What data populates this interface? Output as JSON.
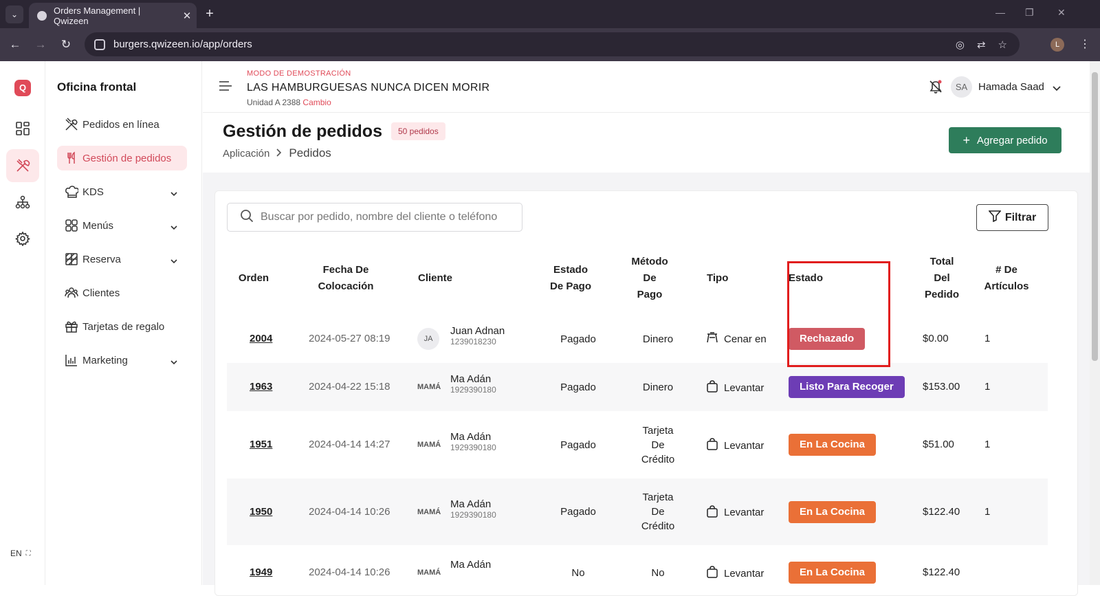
{
  "browser": {
    "tab_title": "Orders Management | Qwizeen",
    "url": "burgers.qwizeen.io/app/orders",
    "profile_initial": "L"
  },
  "sidebar": {
    "title": "Oficina frontal",
    "items": [
      {
        "label": "Pedidos en línea",
        "icon": "dining-icon"
      },
      {
        "label": "Gestión de pedidos",
        "icon": "fork-knife-icon"
      },
      {
        "label": "KDS",
        "icon": "chef-hat-icon"
      },
      {
        "label": "Menús",
        "icon": "grid-icon"
      },
      {
        "label": "Reserva",
        "icon": "table-icon"
      },
      {
        "label": "Clientes",
        "icon": "users-icon"
      },
      {
        "label": "Tarjetas de regalo",
        "icon": "gift-icon"
      },
      {
        "label": "Marketing",
        "icon": "chart-icon"
      }
    ],
    "lang": "EN"
  },
  "header": {
    "demo_label": "MODO DE DEMOSTRACIÓN",
    "store_name": "LAS HAMBURGUESAS NUNCA DICEN MORIR",
    "unit": "Unidad A 2388",
    "change_link": "Cambio",
    "user_initials": "SA",
    "user_name": "Hamada Saad"
  },
  "page": {
    "title": "Gestión de pedidos",
    "count_badge": "50 pedidos",
    "breadcrumb": [
      "Aplicación",
      "Pedidos"
    ],
    "add_button": "Agregar pedido",
    "search_placeholder": "Buscar por pedido, nombre del cliente o teléfono",
    "filter_button": "Filtrar"
  },
  "table": {
    "columns": [
      {
        "key": "order",
        "lines": [
          "Orden"
        ]
      },
      {
        "key": "date",
        "lines": [
          "Fecha De",
          "Colocación"
        ]
      },
      {
        "key": "customer",
        "lines": [
          "Cliente"
        ]
      },
      {
        "key": "pay_status",
        "lines": [
          "Estado",
          "De Pago"
        ]
      },
      {
        "key": "pay_method",
        "lines": [
          "Método",
          "De",
          "Pago"
        ]
      },
      {
        "key": "type",
        "lines": [
          "Tipo"
        ]
      },
      {
        "key": "status",
        "lines": [
          "Estado"
        ]
      },
      {
        "key": "total",
        "lines": [
          "Total",
          "Del",
          "Pedido"
        ]
      },
      {
        "key": "items",
        "lines": [
          "# De",
          "Artículos"
        ]
      }
    ],
    "rows": [
      {
        "order": "2004",
        "date": "2024-05-27 08:19",
        "initials": "JA",
        "name": "Juan Adnan",
        "phone": "1239018230",
        "pay_status": [
          "Pagado"
        ],
        "pay_method": [
          "Dinero"
        ],
        "type": "Cenar en",
        "type_icon": "dine-in-icon",
        "status": "Rechazado",
        "status_color": "#d05a63",
        "total": "$0.00",
        "items": "1"
      },
      {
        "order": "1963",
        "date": "2024-04-22 15:18",
        "initials": "MAMÁ",
        "name": "Ma Adán",
        "phone": "1929390180",
        "pay_status": [
          "Pagado"
        ],
        "pay_method": [
          "Dinero"
        ],
        "type": "Levantar",
        "type_icon": "bag-icon",
        "status": "Listo Para Recoger",
        "status_color": "#6d3db5",
        "total": "$153.00",
        "items": "1"
      },
      {
        "order": "1951",
        "date": "2024-04-14 14:27",
        "initials": "MAMÁ",
        "name": "Ma Adán",
        "phone": "1929390180",
        "pay_status": [
          "Pagado"
        ],
        "pay_method": [
          "Tarjeta",
          "De",
          "Crédito"
        ],
        "type": "Levantar",
        "type_icon": "bag-icon",
        "status": "En La Cocina",
        "status_color": "#ea7037",
        "total": "$51.00",
        "items": "1"
      },
      {
        "order": "1950",
        "date": "2024-04-14 10:26",
        "initials": "MAMÁ",
        "name": "Ma Adán",
        "phone": "1929390180",
        "pay_status": [
          "Pagado"
        ],
        "pay_method": [
          "Tarjeta",
          "De",
          "Crédito"
        ],
        "type": "Levantar",
        "type_icon": "bag-icon",
        "status": "En La Cocina",
        "status_color": "#ea7037",
        "total": "$122.40",
        "items": "1"
      },
      {
        "order": "1949",
        "date": "2024-04-14 10:26",
        "initials": "MAMÁ",
        "name": "Ma Adán",
        "phone": "",
        "pay_status": [
          "No"
        ],
        "pay_method": [
          "No"
        ],
        "type": "Levantar",
        "type_icon": "bag-icon",
        "status": "En La Cocina",
        "status_color": "#ea7037",
        "total": "$122.40",
        "items": ""
      }
    ]
  },
  "colors": {
    "brand": "#e04a58",
    "primary_button": "#2e7d5b",
    "highlight_box": "#e11d1d"
  }
}
